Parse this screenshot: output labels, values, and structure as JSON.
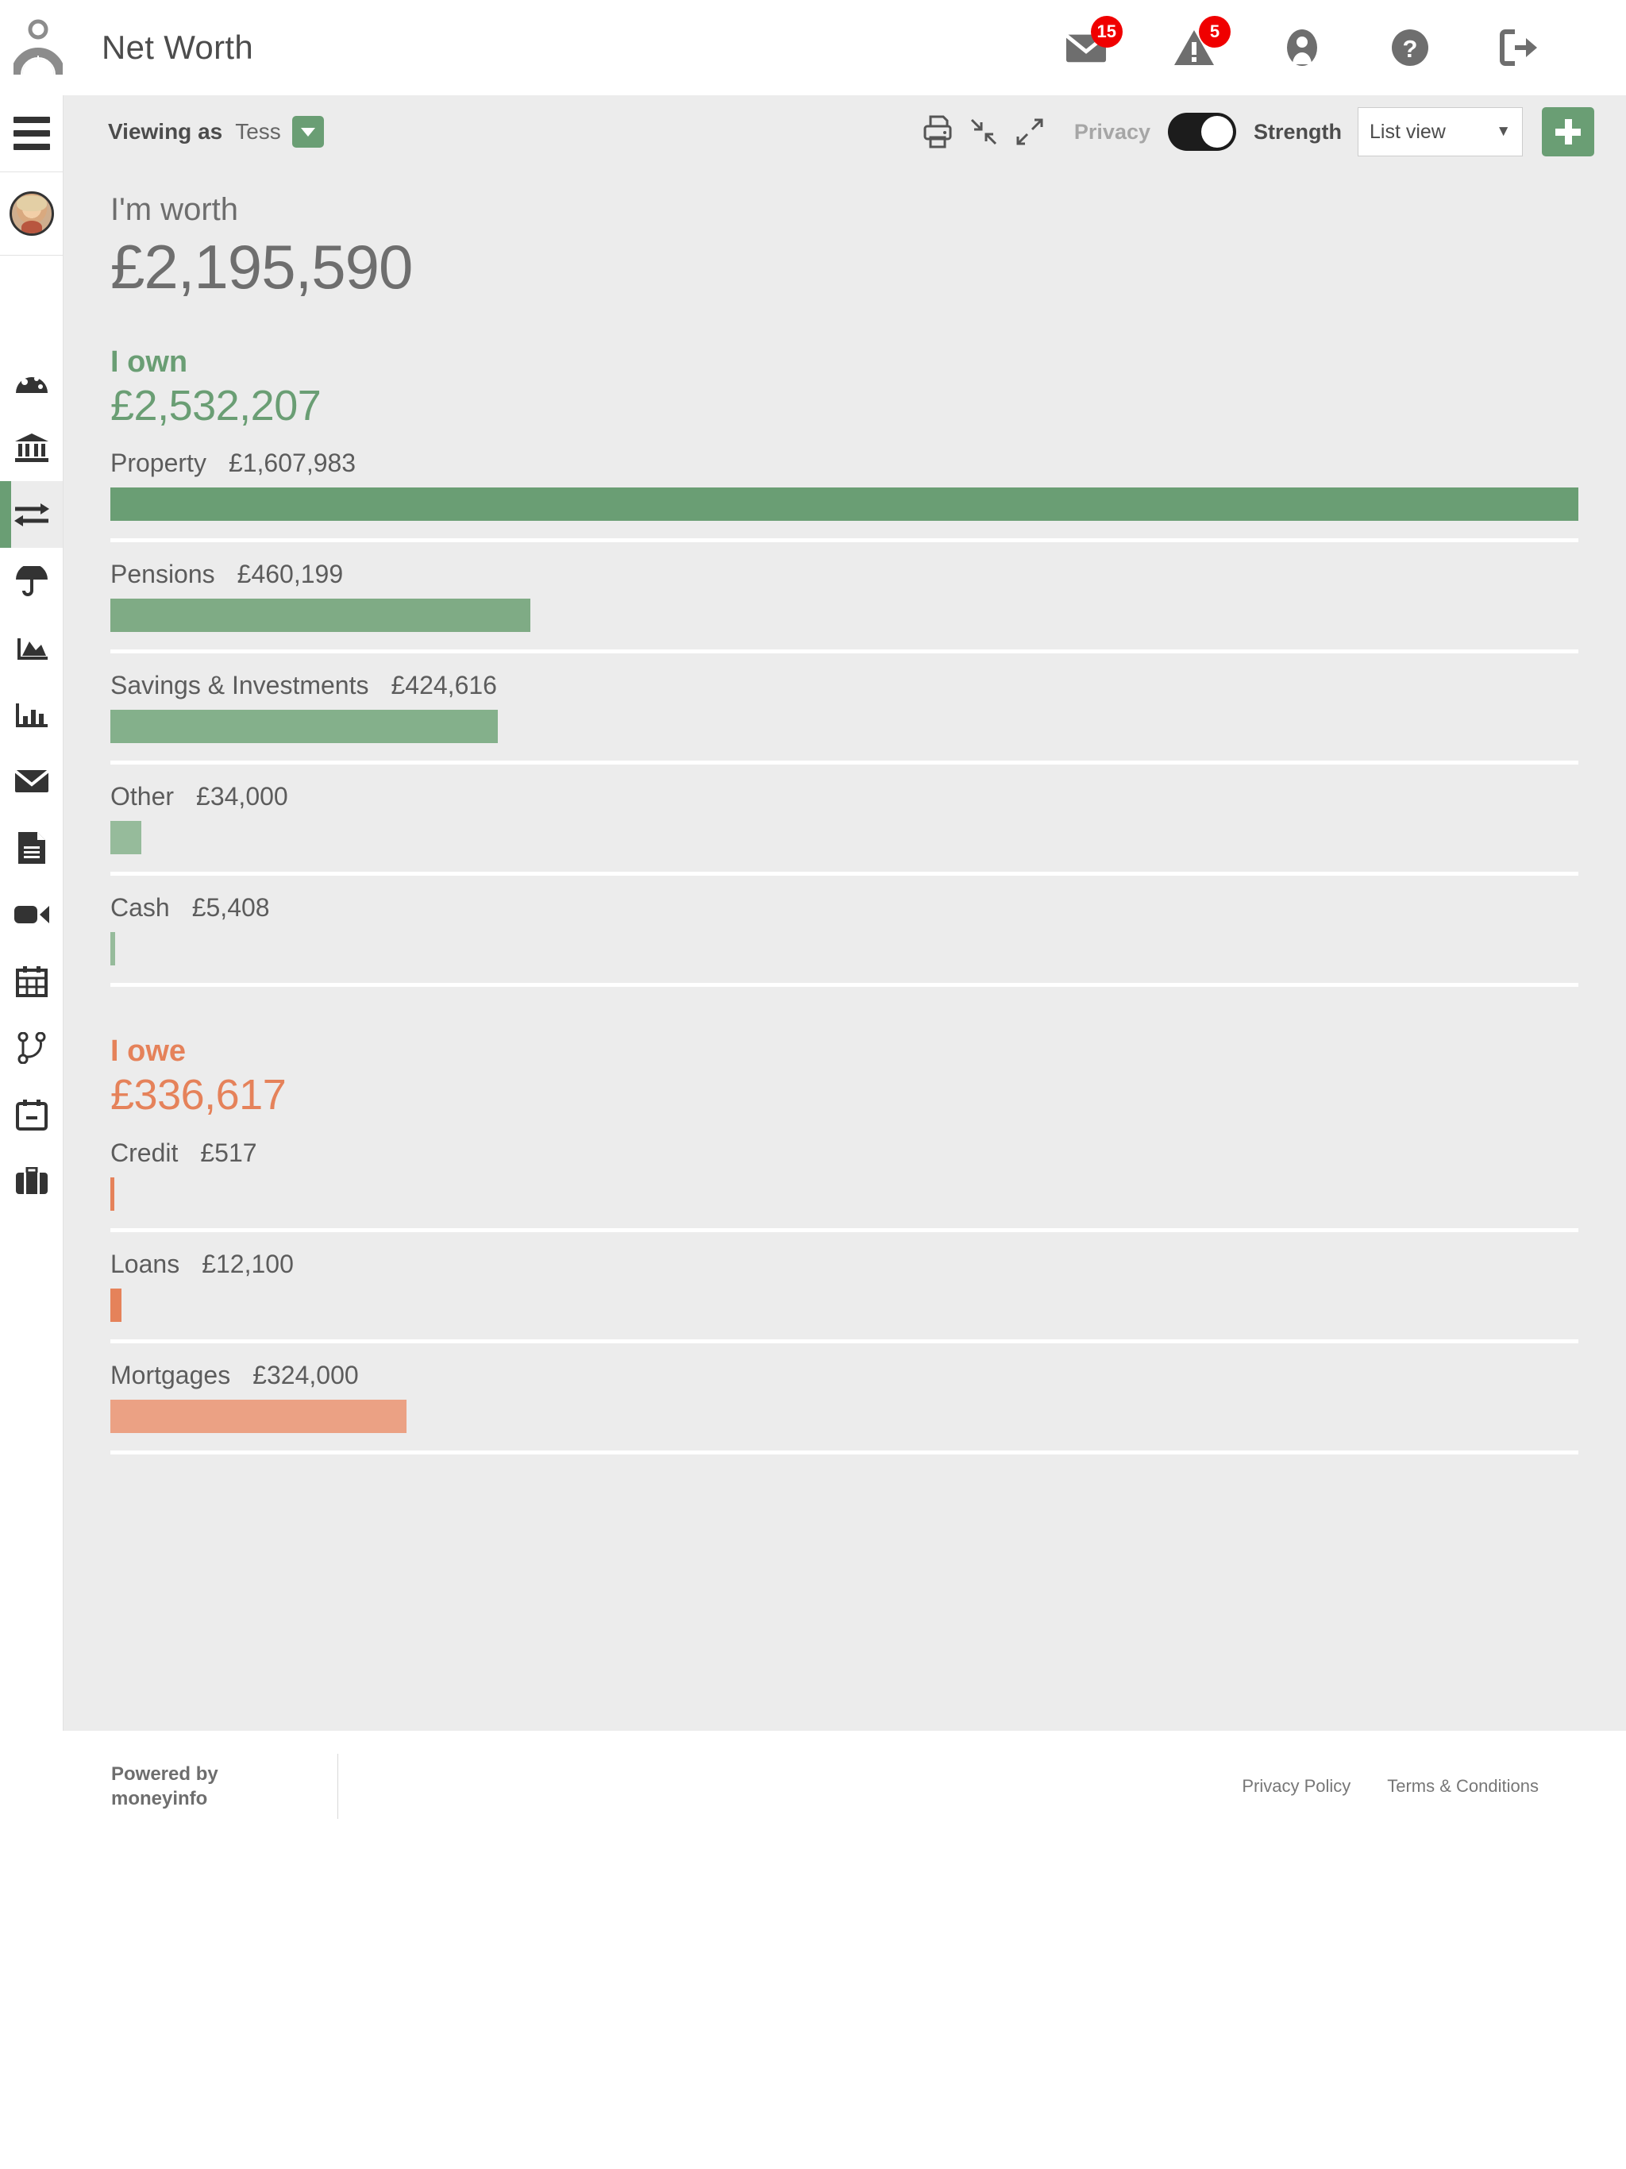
{
  "header": {
    "title": "Net Worth",
    "logo_icon": "person-gauge-logo",
    "icons": [
      {
        "name": "messages-icon",
        "glyph": "envelope",
        "badge": "15"
      },
      {
        "name": "alerts-icon",
        "glyph": "warning-triangle",
        "badge": "5"
      },
      {
        "name": "account-icon",
        "glyph": "person-circle",
        "badge": ""
      },
      {
        "name": "help-icon",
        "glyph": "question-circle",
        "badge": ""
      },
      {
        "name": "logout-icon",
        "glyph": "sign-out",
        "badge": ""
      }
    ]
  },
  "sidebar": {
    "menu_icon": "hamburger-menu-icon",
    "avatar_icon": "user-avatar",
    "items": [
      {
        "name": "sidebar-item-dashboard",
        "icon": "speedometer-icon",
        "active": false
      },
      {
        "name": "sidebar-item-accounts",
        "icon": "bank-icon",
        "active": false
      },
      {
        "name": "sidebar-item-net-worth",
        "icon": "transfer-arrows-icon",
        "active": true
      },
      {
        "name": "sidebar-item-protection",
        "icon": "umbrella-icon",
        "active": false
      },
      {
        "name": "sidebar-item-performance",
        "icon": "area-chart-icon",
        "active": false
      },
      {
        "name": "sidebar-item-reports",
        "icon": "bar-chart-icon",
        "active": false
      },
      {
        "name": "sidebar-item-messages",
        "icon": "envelope-icon",
        "active": false
      },
      {
        "name": "sidebar-item-documents",
        "icon": "document-icon",
        "active": false
      },
      {
        "name": "sidebar-item-video",
        "icon": "video-camera-icon",
        "active": false
      },
      {
        "name": "sidebar-item-calendar",
        "icon": "calendar-grid-icon",
        "active": false
      },
      {
        "name": "sidebar-item-connections",
        "icon": "branch-icon",
        "active": false
      },
      {
        "name": "sidebar-item-events",
        "icon": "calendar-outline-icon",
        "active": false
      },
      {
        "name": "sidebar-item-portfolio",
        "icon": "briefcase-icon",
        "active": false
      }
    ]
  },
  "toolbar": {
    "viewing_as_label": "Viewing as",
    "viewing_as_name": "Tess",
    "dropdown_icon": "chevron-down-icon",
    "print_icon": "printer-icon",
    "collapse_icon": "collapse-arrows-icon",
    "expand_icon": "expand-arrows-icon",
    "privacy_label": "Privacy",
    "toggle_state": "on",
    "strength_label": "Strength",
    "view_select_value": "List view",
    "view_select_options": [
      "List view"
    ],
    "view_select_caret": "▼",
    "add_button_icon": "plus-icon"
  },
  "main": {
    "worth_label": "I'm worth",
    "worth_value": "£2,195,590",
    "own": {
      "title": "I own",
      "total": "£2,532,207"
    },
    "owe": {
      "title": "I owe",
      "total": "£336,617"
    }
  },
  "chart_data": {
    "type": "bar",
    "title": "Net Worth breakdown",
    "orientation": "horizontal",
    "net_worth": 2195590,
    "currency": "£",
    "axis_max": 1607983,
    "grid": false,
    "legend": "none",
    "series": [
      {
        "name": "I own",
        "total": 2532207,
        "total_label": "£2,532,207",
        "color": "#6a9e74",
        "categories": [
          "Property",
          "Pensions",
          "Savings & Investments",
          "Other",
          "Cash"
        ],
        "values": [
          1607983,
          460199,
          424616,
          34000,
          5408
        ],
        "value_labels": [
          "£1,607,983",
          "£460,199",
          "£424,616",
          "£34,000",
          "£5,408"
        ],
        "bar_colors": [
          "#6a9e74",
          "#7fab85",
          "#84b08b",
          "#96bb9b",
          "#96bb9b"
        ],
        "bar_widths_pct": [
          100.0,
          28.6,
          26.4,
          2.1,
          0.34
        ]
      },
      {
        "name": "I owe",
        "total": 336617,
        "total_label": "£336,617",
        "color": "#e5825a",
        "categories": [
          "Credit",
          "Loans",
          "Mortgages"
        ],
        "values": [
          517,
          12100,
          324000
        ],
        "value_labels": [
          "£517",
          "£12,100",
          "£324,000"
        ],
        "bar_colors": [
          "#e5825a",
          "#e5825a",
          "#eba184"
        ],
        "bar_widths_pct": [
          0.16,
          0.75,
          20.15
        ]
      }
    ]
  },
  "footer": {
    "powered_line1": "Powered by",
    "powered_line2": "moneyinfo",
    "links": [
      "Privacy Policy",
      "Terms & Conditions"
    ]
  }
}
